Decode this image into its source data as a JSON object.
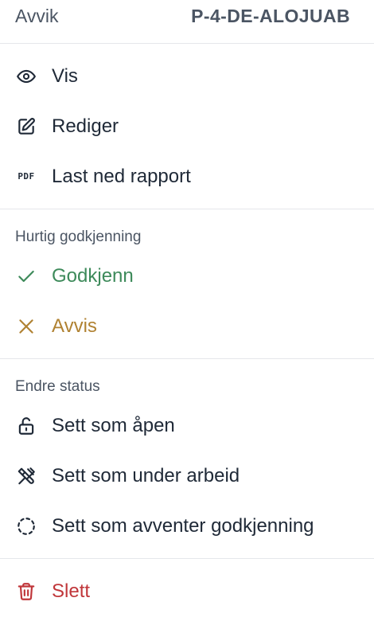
{
  "header": {
    "title": "Avvik",
    "reference": "P-4-DE-ALOJUAB"
  },
  "actions": {
    "view": {
      "label": "Vis",
      "icon": "eye-icon"
    },
    "edit": {
      "label": "Rediger",
      "icon": "edit-icon"
    },
    "download": {
      "label": "Last ned rapport",
      "icon": "pdf-icon",
      "icon_text": "PDF"
    }
  },
  "quick_approval": {
    "label": "Hurtig godkjenning",
    "approve": {
      "label": "Godkjenn",
      "icon": "check-icon",
      "color": "#3d8a5a"
    },
    "reject": {
      "label": "Avvis",
      "icon": "x-icon",
      "color": "#b08232"
    }
  },
  "change_status": {
    "label": "Endre status",
    "open": {
      "label": "Sett som åpen",
      "icon": "unlock-icon"
    },
    "in_progress": {
      "label": "Sett som under arbeid",
      "icon": "tools-icon"
    },
    "pending": {
      "label": "Sett som avventer godkjenning",
      "icon": "dashed-circle-icon"
    }
  },
  "danger": {
    "delete": {
      "label": "Slett",
      "icon": "trash-icon",
      "color": "#c0363a"
    }
  }
}
